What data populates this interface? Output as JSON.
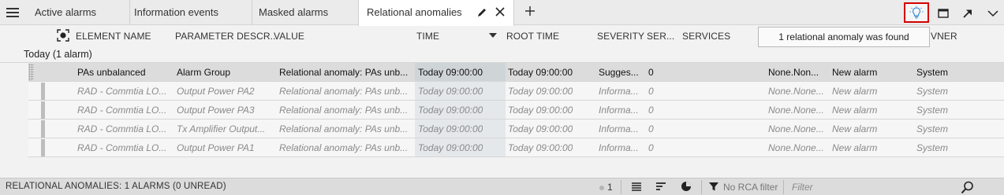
{
  "tabs": [
    {
      "label": "Active alarms"
    },
    {
      "label": "Information events"
    },
    {
      "label": "Masked alarms"
    },
    {
      "label": "Relational anomalies"
    }
  ],
  "icons": {
    "menu": "hamburger-icon",
    "edit": "pencil-icon",
    "close": "close-icon",
    "add": "plus-icon",
    "insight": "lightbulb-icon",
    "window": "window-icon",
    "popout": "arrow-out-icon",
    "collapse": "chevron-down-icon"
  },
  "columns": {
    "element_name": "ELEMENT NAME",
    "parameter_description": "PARAMETER DESCR...",
    "value": "VALUE",
    "time": "TIME",
    "root_time": "ROOT TIME",
    "severity": "SEVERITY",
    "service_abbrev": "SER...",
    "services": "SERVICES",
    "owner_partial": "VNER"
  },
  "tooltip": "1 relational anomaly was found",
  "group": {
    "label": "Today (1 alarm)"
  },
  "rows": [
    {
      "element": "PAs unbalanced",
      "parameter": "Alarm Group",
      "value": "Relational anomaly: PAs unb...",
      "time": "Today 09:00:00",
      "root_time": "Today 09:00:00",
      "severity": "Sugges...",
      "ser": "0",
      "nonenone": "None.Non...",
      "alarm_type": "New alarm",
      "owner": "System"
    },
    {
      "element": "RAD - Commtia LO...",
      "parameter": "Output Power PA2",
      "value": "Relational anomaly: PAs unb...",
      "time": "Today 09:00:00",
      "root_time": "Today 09:00:00",
      "severity": "Informa...",
      "ser": "0",
      "nonenone": "None.None...",
      "alarm_type": "New alarm",
      "owner": "System"
    },
    {
      "element": "RAD - Commtia LO...",
      "parameter": "Output Power PA3",
      "value": "Relational anomaly: PAs unb...",
      "time": "Today 09:00:00",
      "root_time": "Today 09:00:00",
      "severity": "Informa...",
      "ser": "0",
      "nonenone": "None.None...",
      "alarm_type": "New alarm",
      "owner": "System"
    },
    {
      "element": "RAD - Commtia LO...",
      "parameter": "Tx Amplifier Output...",
      "value": "Relational anomaly: PAs unb...",
      "time": "Today 09:00:00",
      "root_time": "Today 09:00:00",
      "severity": "Informa...",
      "ser": "0",
      "nonenone": "None.None...",
      "alarm_type": "New alarm",
      "owner": "System"
    },
    {
      "element": "RAD - Commtia LO...",
      "parameter": "Output Power PA1",
      "value": "Relational anomaly: PAs unb...",
      "time": "Today 09:00:00",
      "root_time": "Today 09:00:00",
      "severity": "Informa...",
      "ser": "0",
      "nonenone": "None.None...",
      "alarm_type": "New alarm",
      "owner": "System"
    }
  ],
  "status": {
    "summary": "RELATIONAL ANOMALIES: 1 ALARMS (0 UNREAD)",
    "count": "1",
    "rca_filter": "No RCA filter",
    "filter_placeholder": "Filter"
  },
  "colors": {
    "highlight_border": "#d40000",
    "insight_icon": "#3c8fd8"
  }
}
